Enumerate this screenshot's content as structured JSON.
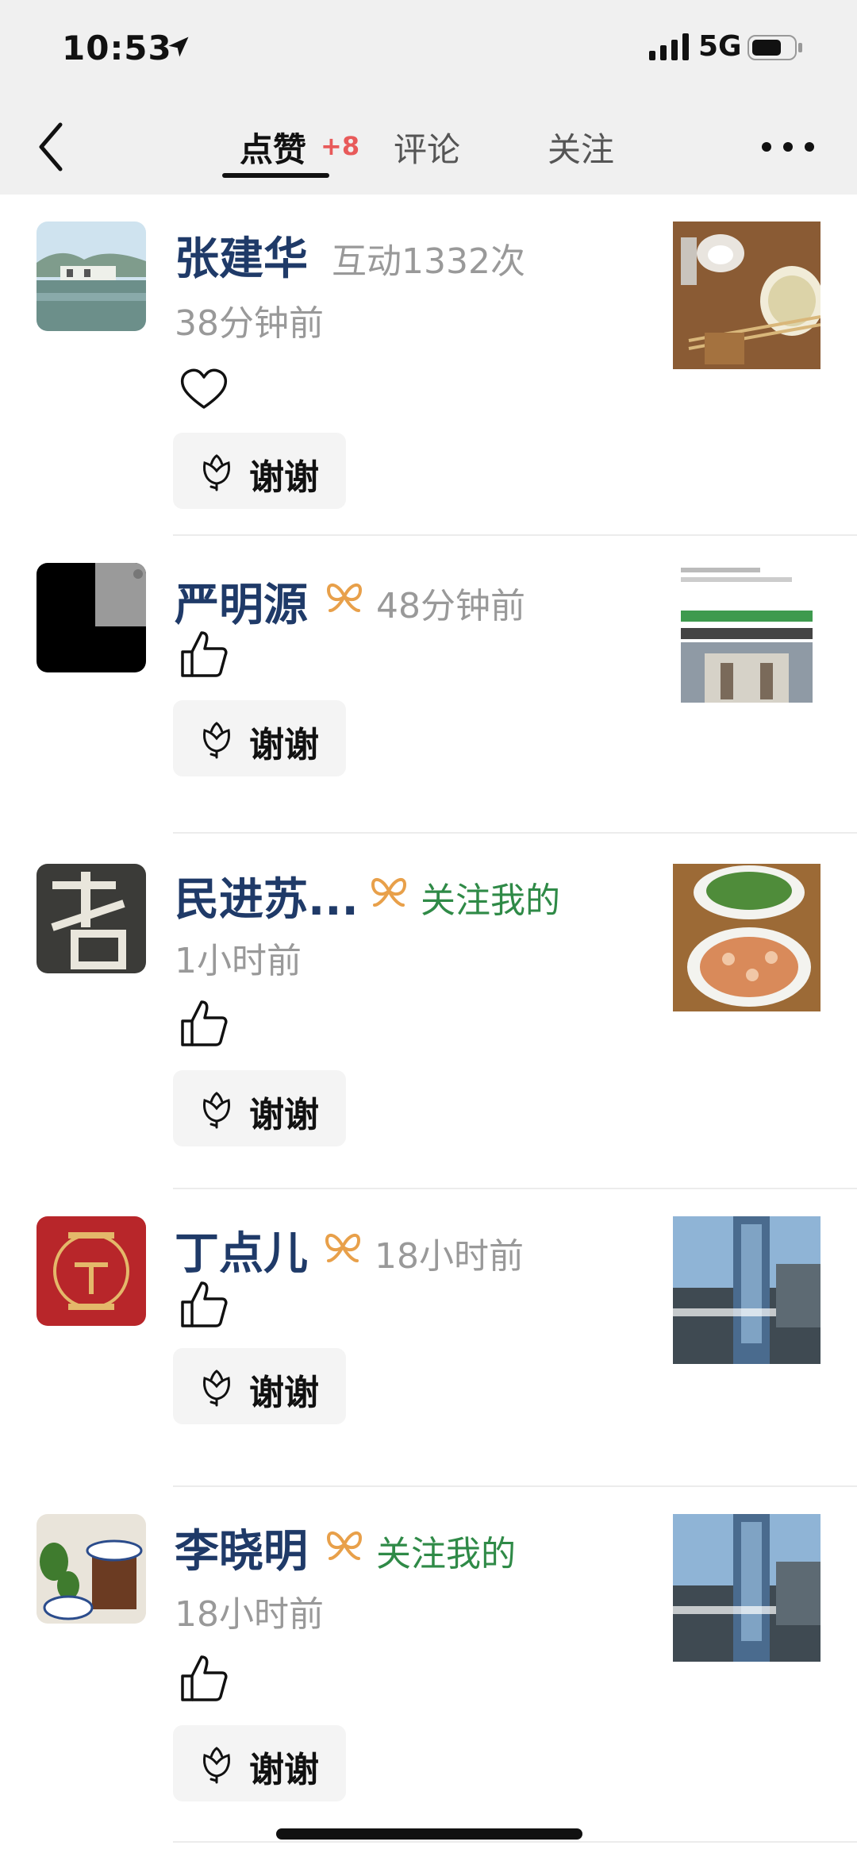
{
  "status_bar": {
    "time": "10:53",
    "network": "5G"
  },
  "nav": {
    "tabs": [
      {
        "label": "点赞",
        "badge": "+8",
        "active": true
      },
      {
        "label": "评论",
        "active": false
      },
      {
        "label": "关注",
        "active": false
      }
    ]
  },
  "items": [
    {
      "name": "张建华",
      "interaction": "互动1332次",
      "time": "38分钟前",
      "reaction": "heart-icon",
      "follow_note": "",
      "thanks_label": "谢谢"
    },
    {
      "name": "严明源",
      "interaction": "",
      "time": "48分钟前",
      "reaction": "thumbs-up-icon",
      "follow_note": "",
      "thanks_label": "谢谢"
    },
    {
      "name": "民进苏...",
      "interaction": "",
      "time": "1小时前",
      "reaction": "thumbs-up-icon",
      "follow_note": "关注我的",
      "thanks_label": "谢谢"
    },
    {
      "name": "丁点儿",
      "interaction": "",
      "time": "18小时前",
      "reaction": "thumbs-up-icon",
      "follow_note": "",
      "thanks_label": "谢谢"
    },
    {
      "name": "李晓明",
      "interaction": "",
      "time": "18小时前",
      "reaction": "thumbs-up-icon",
      "follow_note": "关注我的",
      "thanks_label": "谢谢"
    }
  ],
  "colors": {
    "name": "#1f3a68",
    "follow_note": "#2f8a47",
    "tab_badge": "#e85a5a",
    "badge_icon": "#e8a04a",
    "muted": "#999999"
  }
}
